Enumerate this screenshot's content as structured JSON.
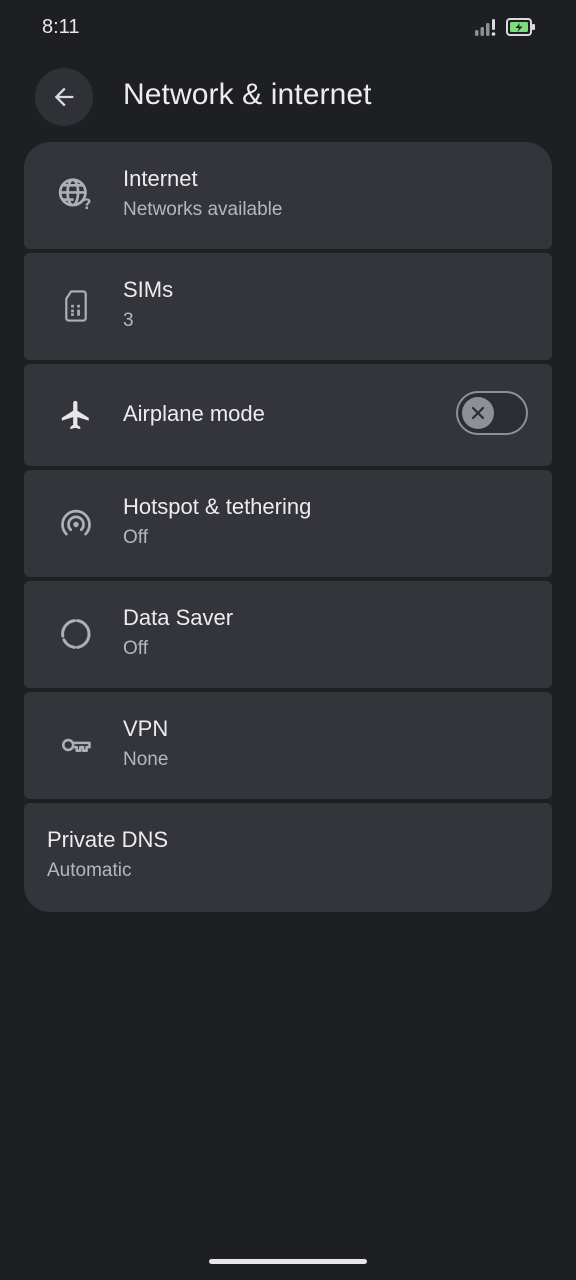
{
  "status_bar": {
    "time": "8:11",
    "battery_charging": true,
    "signal_alert": true
  },
  "header": {
    "title": "Network & internet",
    "back_icon": "arrow-back-icon"
  },
  "settings": [
    {
      "id": "internet",
      "title": "Internet",
      "subtitle": "Networks available",
      "icon": "globe-question-icon"
    },
    {
      "id": "sims",
      "title": "SIMs",
      "subtitle": "3",
      "icon": "sim-card-icon"
    },
    {
      "id": "airplane",
      "title": "Airplane mode",
      "icon": "airplane-icon",
      "toggle": "off"
    },
    {
      "id": "hotspot",
      "title": "Hotspot & tethering",
      "subtitle": "Off",
      "icon": "hotspot-icon"
    },
    {
      "id": "data-saver",
      "title": "Data Saver",
      "subtitle": "Off",
      "icon": "data-saver-icon"
    },
    {
      "id": "vpn",
      "title": "VPN",
      "subtitle": "None",
      "icon": "key-icon"
    },
    {
      "id": "private-dns",
      "title": "Private DNS",
      "subtitle": "Automatic"
    }
  ],
  "colors": {
    "background": "#1e1f23",
    "card": "#33353b",
    "text": "#ececf0",
    "subtext": "#b5b7bf",
    "battery": "#7ddc7a"
  }
}
